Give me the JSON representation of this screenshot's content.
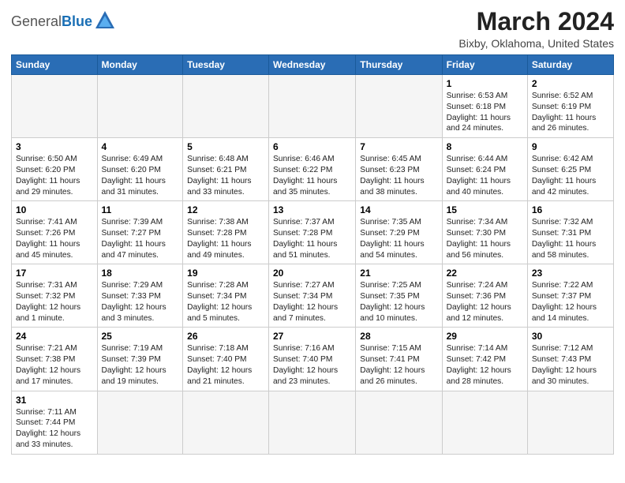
{
  "header": {
    "logo_general": "General",
    "logo_blue": "Blue",
    "title": "March 2024",
    "subtitle": "Bixby, Oklahoma, United States"
  },
  "weekdays": [
    "Sunday",
    "Monday",
    "Tuesday",
    "Wednesday",
    "Thursday",
    "Friday",
    "Saturday"
  ],
  "weeks": [
    [
      {
        "day": "",
        "info": ""
      },
      {
        "day": "",
        "info": ""
      },
      {
        "day": "",
        "info": ""
      },
      {
        "day": "",
        "info": ""
      },
      {
        "day": "",
        "info": ""
      },
      {
        "day": "1",
        "info": "Sunrise: 6:53 AM\nSunset: 6:18 PM\nDaylight: 11 hours\nand 24 minutes."
      },
      {
        "day": "2",
        "info": "Sunrise: 6:52 AM\nSunset: 6:19 PM\nDaylight: 11 hours\nand 26 minutes."
      }
    ],
    [
      {
        "day": "3",
        "info": "Sunrise: 6:50 AM\nSunset: 6:20 PM\nDaylight: 11 hours\nand 29 minutes."
      },
      {
        "day": "4",
        "info": "Sunrise: 6:49 AM\nSunset: 6:20 PM\nDaylight: 11 hours\nand 31 minutes."
      },
      {
        "day": "5",
        "info": "Sunrise: 6:48 AM\nSunset: 6:21 PM\nDaylight: 11 hours\nand 33 minutes."
      },
      {
        "day": "6",
        "info": "Sunrise: 6:46 AM\nSunset: 6:22 PM\nDaylight: 11 hours\nand 35 minutes."
      },
      {
        "day": "7",
        "info": "Sunrise: 6:45 AM\nSunset: 6:23 PM\nDaylight: 11 hours\nand 38 minutes."
      },
      {
        "day": "8",
        "info": "Sunrise: 6:44 AM\nSunset: 6:24 PM\nDaylight: 11 hours\nand 40 minutes."
      },
      {
        "day": "9",
        "info": "Sunrise: 6:42 AM\nSunset: 6:25 PM\nDaylight: 11 hours\nand 42 minutes."
      }
    ],
    [
      {
        "day": "10",
        "info": "Sunrise: 7:41 AM\nSunset: 7:26 PM\nDaylight: 11 hours\nand 45 minutes."
      },
      {
        "day": "11",
        "info": "Sunrise: 7:39 AM\nSunset: 7:27 PM\nDaylight: 11 hours\nand 47 minutes."
      },
      {
        "day": "12",
        "info": "Sunrise: 7:38 AM\nSunset: 7:28 PM\nDaylight: 11 hours\nand 49 minutes."
      },
      {
        "day": "13",
        "info": "Sunrise: 7:37 AM\nSunset: 7:28 PM\nDaylight: 11 hours\nand 51 minutes."
      },
      {
        "day": "14",
        "info": "Sunrise: 7:35 AM\nSunset: 7:29 PM\nDaylight: 11 hours\nand 54 minutes."
      },
      {
        "day": "15",
        "info": "Sunrise: 7:34 AM\nSunset: 7:30 PM\nDaylight: 11 hours\nand 56 minutes."
      },
      {
        "day": "16",
        "info": "Sunrise: 7:32 AM\nSunset: 7:31 PM\nDaylight: 11 hours\nand 58 minutes."
      }
    ],
    [
      {
        "day": "17",
        "info": "Sunrise: 7:31 AM\nSunset: 7:32 PM\nDaylight: 12 hours\nand 1 minute."
      },
      {
        "day": "18",
        "info": "Sunrise: 7:29 AM\nSunset: 7:33 PM\nDaylight: 12 hours\nand 3 minutes."
      },
      {
        "day": "19",
        "info": "Sunrise: 7:28 AM\nSunset: 7:34 PM\nDaylight: 12 hours\nand 5 minutes."
      },
      {
        "day": "20",
        "info": "Sunrise: 7:27 AM\nSunset: 7:34 PM\nDaylight: 12 hours\nand 7 minutes."
      },
      {
        "day": "21",
        "info": "Sunrise: 7:25 AM\nSunset: 7:35 PM\nDaylight: 12 hours\nand 10 minutes."
      },
      {
        "day": "22",
        "info": "Sunrise: 7:24 AM\nSunset: 7:36 PM\nDaylight: 12 hours\nand 12 minutes."
      },
      {
        "day": "23",
        "info": "Sunrise: 7:22 AM\nSunset: 7:37 PM\nDaylight: 12 hours\nand 14 minutes."
      }
    ],
    [
      {
        "day": "24",
        "info": "Sunrise: 7:21 AM\nSunset: 7:38 PM\nDaylight: 12 hours\nand 17 minutes."
      },
      {
        "day": "25",
        "info": "Sunrise: 7:19 AM\nSunset: 7:39 PM\nDaylight: 12 hours\nand 19 minutes."
      },
      {
        "day": "26",
        "info": "Sunrise: 7:18 AM\nSunset: 7:40 PM\nDaylight: 12 hours\nand 21 minutes."
      },
      {
        "day": "27",
        "info": "Sunrise: 7:16 AM\nSunset: 7:40 PM\nDaylight: 12 hours\nand 23 minutes."
      },
      {
        "day": "28",
        "info": "Sunrise: 7:15 AM\nSunset: 7:41 PM\nDaylight: 12 hours\nand 26 minutes."
      },
      {
        "day": "29",
        "info": "Sunrise: 7:14 AM\nSunset: 7:42 PM\nDaylight: 12 hours\nand 28 minutes."
      },
      {
        "day": "30",
        "info": "Sunrise: 7:12 AM\nSunset: 7:43 PM\nDaylight: 12 hours\nand 30 minutes."
      }
    ],
    [
      {
        "day": "31",
        "info": "Sunrise: 7:11 AM\nSunset: 7:44 PM\nDaylight: 12 hours\nand 33 minutes."
      },
      {
        "day": "",
        "info": ""
      },
      {
        "day": "",
        "info": ""
      },
      {
        "day": "",
        "info": ""
      },
      {
        "day": "",
        "info": ""
      },
      {
        "day": "",
        "info": ""
      },
      {
        "day": "",
        "info": ""
      }
    ]
  ]
}
